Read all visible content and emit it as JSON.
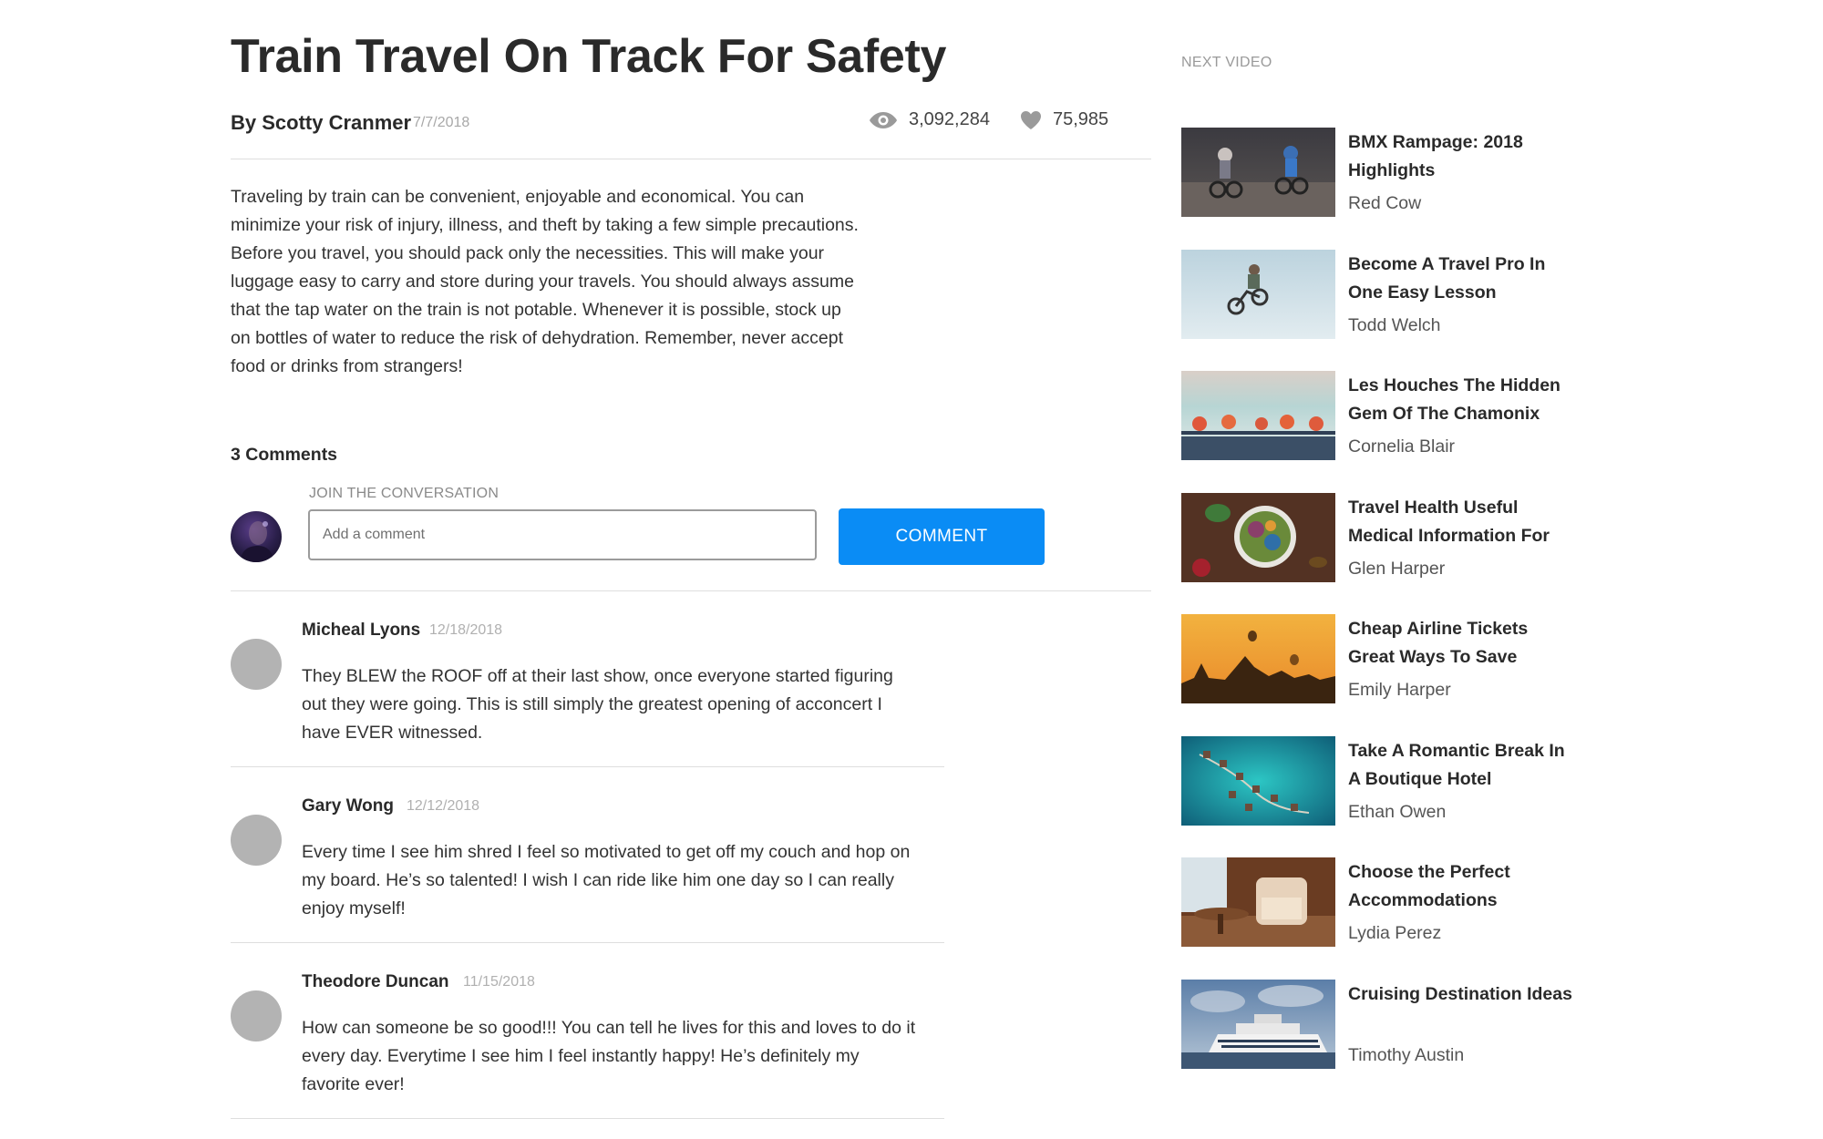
{
  "article": {
    "title": "Train Travel On Track For Safety",
    "byline": "By Scotty Cranmer",
    "date": "7/7/2018",
    "views": "3,092,284",
    "likes": "75,985",
    "body": "Traveling by train can be convenient, enjoyable and economical. You can minimize your risk of injury, illness, and theft by taking a few simple precautions. Before you travel, you should pack only the necessities. This will make your luggage easy to carry and store during your travels. You should always assume that the tap water on the train is not potable. Whenever it is possible, stock up on bottles of water to reduce the risk of dehydration. Remember, never accept food or drinks from strangers!"
  },
  "comments_section": {
    "count_label": "3 Comments",
    "join_label": "JOIN THE CONVERSATION",
    "input_placeholder": "Add a comment",
    "input_value": "",
    "button_label": "COMMENT"
  },
  "comments": [
    {
      "name": "Micheal Lyons",
      "date": "12/18/2018",
      "text": "They BLEW the ROOF off at their last show, once everyone started figuring out they were going. This is still simply the greatest opening of acconcert I have EVER witnessed."
    },
    {
      "name": "Gary Wong",
      "date": "12/12/2018",
      "text": "Every time I see him shred I feel so motivated to get off my couch and hop on my board. He’s so talented! I wish I can ride like him one day so I can really enjoy myself!"
    },
    {
      "name": "Theodore Duncan",
      "date": "11/15/2018",
      "text": "How can someone be so good!!! You can tell he lives for this and loves to do it every day. Everytime I see him I feel instantly happy! He’s definitely my favorite ever!"
    }
  ],
  "sidebar": {
    "label": "NEXT VIDEO",
    "videos": [
      {
        "title": "BMX Rampage: 2018 Highlights",
        "author": "Red Cow"
      },
      {
        "title": "Become A Travel Pro In One Easy Lesson",
        "author": "Todd Welch"
      },
      {
        "title": "Les Houches The Hidden Gem Of The Chamonix",
        "author": "Cornelia Blair"
      },
      {
        "title": "Travel Health Useful Medical Information For",
        "author": "Glen Harper"
      },
      {
        "title": "Cheap Airline Tickets Great Ways To Save",
        "author": "Emily Harper"
      },
      {
        "title": "Take A Romantic Break In A Boutique Hotel",
        "author": "Ethan Owen"
      },
      {
        "title": "Choose the Perfect Accommodations",
        "author": "Lydia Perez"
      },
      {
        "title": "Cruising Destination Ideas",
        "author": "Timothy Austin"
      }
    ]
  },
  "colors": {
    "accent": "#0a8cf5",
    "text": "#2a2a2a",
    "muted": "#a8a8a8",
    "divider": "#dedede",
    "avatar_placeholder": "#b3b3b3"
  },
  "icons": {
    "views": "eye-icon",
    "likes": "heart-icon"
  }
}
